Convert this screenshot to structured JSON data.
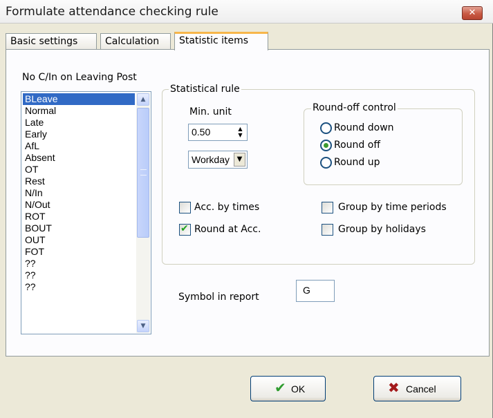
{
  "window": {
    "title": "Formulate attendance checking rule",
    "close_glyph": "✕"
  },
  "tabs": [
    {
      "label": "Basic settings",
      "active": false
    },
    {
      "label": "Calculation",
      "active": false
    },
    {
      "label": "Statistic items",
      "active": true
    }
  ],
  "items_list": {
    "caption": "No C/In on Leaving Post",
    "items": [
      "BLeave",
      "Normal",
      "Late",
      "Early",
      "AfL",
      "Absent",
      "OT",
      "Rest",
      "N/In",
      "N/Out",
      "ROT",
      "BOUT",
      "OUT",
      "FOT",
      "??",
      "??",
      "??"
    ],
    "selected": "BLeave"
  },
  "statistical_rule": {
    "legend": "Statistical rule",
    "min_unit": {
      "label": "Min. unit",
      "value": "0.50",
      "unit_selected": "Workday"
    },
    "round_off": {
      "legend": "Round-off control",
      "options": [
        "Round down",
        "Round off",
        "Round up"
      ],
      "selected": "Round off"
    },
    "checks": {
      "acc_by_times": {
        "label": "Acc. by times",
        "checked": false
      },
      "round_at_acc": {
        "label": "Round at Acc.",
        "checked": true
      },
      "group_by_time_periods": {
        "label": "Group by time periods",
        "checked": false
      },
      "group_by_holidays": {
        "label": "Group by holidays",
        "checked": false
      }
    }
  },
  "symbol": {
    "label": "Symbol in report",
    "value": "G"
  },
  "buttons": {
    "ok": {
      "label": "OK",
      "icon": "checkmark-icon",
      "icon_color": "#2e9c2e"
    },
    "cancel": {
      "label": "Cancel",
      "icon": "x-icon",
      "icon_color": "#a3191b"
    }
  },
  "colors": {
    "selection": "#316ac5",
    "active_tab_accent": "#f7b64a",
    "dialog_background": "#ece9d8"
  }
}
